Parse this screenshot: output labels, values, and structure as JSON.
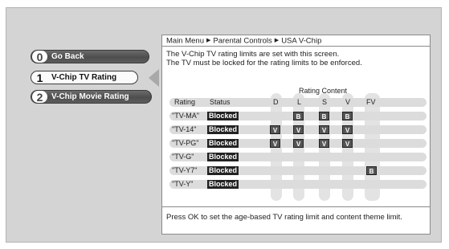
{
  "menu": {
    "items": [
      {
        "num": "0",
        "label": "Go Back"
      },
      {
        "num": "1",
        "label": "V-Chip TV Rating"
      },
      {
        "num": "2",
        "label": "V-Chip Movie Rating"
      }
    ]
  },
  "breadcrumb": {
    "items": [
      "Main Menu",
      "Parental Controls",
      "USA V-Chip"
    ],
    "separator": "▶"
  },
  "description": {
    "line1": "The V-Chip TV rating limits are set with this screen.",
    "line2": "The TV must be locked for the rating limits to be enforced."
  },
  "table": {
    "group_label": "Rating Content",
    "headers": {
      "rating": "Rating",
      "status": "Status",
      "d": "D",
      "l": "L",
      "s": "S",
      "v": "V",
      "fv": "FV"
    },
    "rows": [
      {
        "rating": "\"TV-MA\"",
        "status": "Blocked",
        "d": "",
        "l": "B",
        "s": "B",
        "v": "B",
        "fv": ""
      },
      {
        "rating": "\"TV-14\"",
        "status": "Blocked",
        "d": "V",
        "l": "V",
        "s": "V",
        "v": "V",
        "fv": ""
      },
      {
        "rating": "\"TV-PG\"",
        "status": "Blocked",
        "d": "V",
        "l": "V",
        "s": "V",
        "v": "V",
        "fv": ""
      },
      {
        "rating": "\"TV-G\"",
        "status": "Blocked",
        "d": "",
        "l": "",
        "s": "",
        "v": "",
        "fv": ""
      },
      {
        "rating": "\"TV-Y7\"",
        "status": "Blocked",
        "d": "",
        "l": "",
        "s": "",
        "v": "",
        "fv": "B"
      },
      {
        "rating": "\"TV-Y\"",
        "status": "Blocked",
        "d": "",
        "l": "",
        "s": "",
        "v": "",
        "fv": ""
      }
    ]
  },
  "footer": {
    "text": "Press OK to set the age-based TV rating limit and content theme limit."
  },
  "colors": {
    "screen_bg": "#d4d4d4",
    "panel_bg": "#ffffff",
    "blocked_tag": "#222222",
    "mark_bg": "#555555"
  }
}
